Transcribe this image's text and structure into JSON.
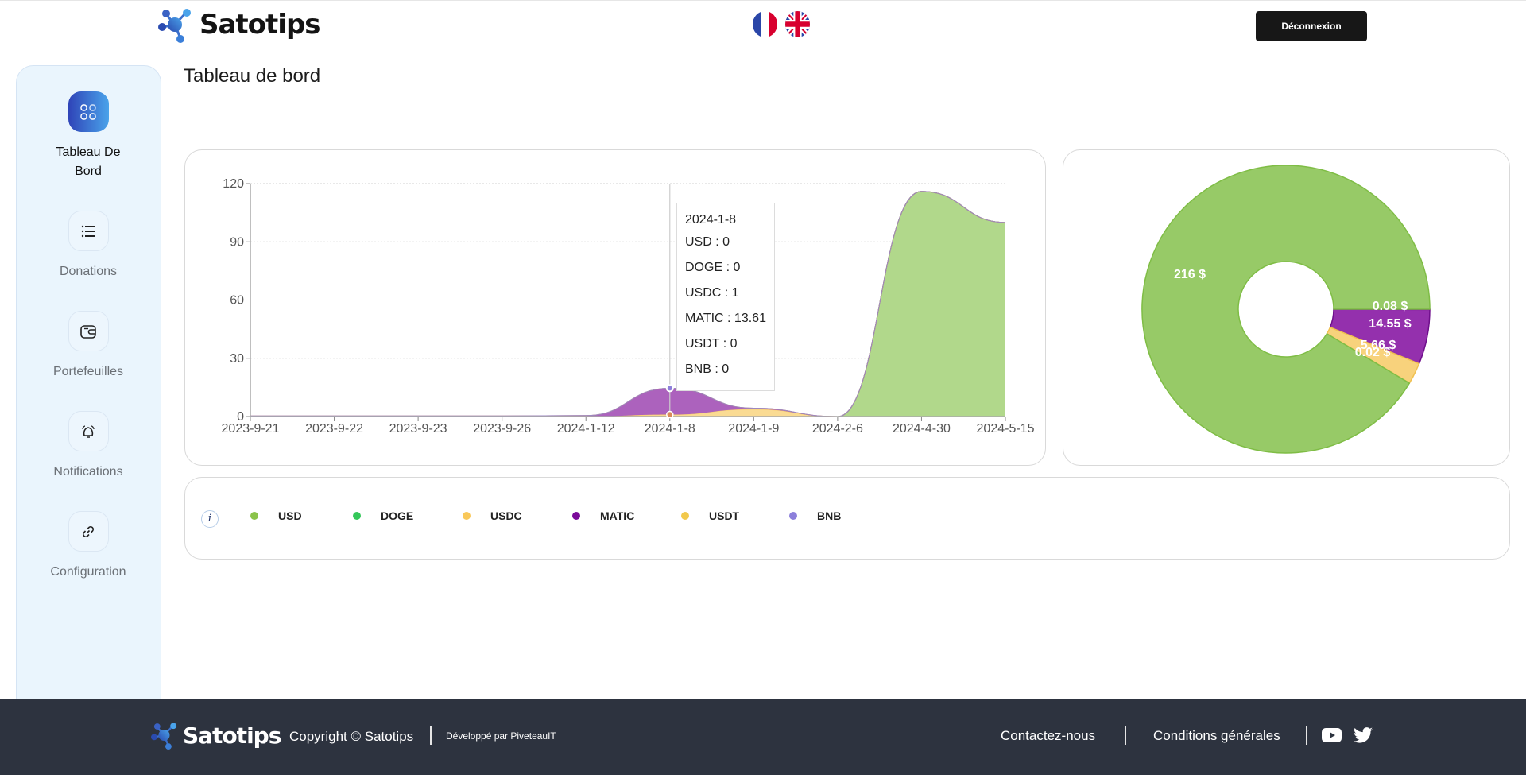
{
  "header": {
    "brand": "Satotips",
    "languages": [
      {
        "code": "fr",
        "label": "Français"
      },
      {
        "code": "en",
        "label": "English"
      }
    ],
    "logout_label": "Déconnexion"
  },
  "sidebar": {
    "items": [
      {
        "label": "Tableau De Bord",
        "icon": "dashboard-icon",
        "active": true
      },
      {
        "label": "Donations",
        "icon": "list-icon",
        "active": false
      },
      {
        "label": "Portefeuilles",
        "icon": "wallet-icon",
        "active": false
      },
      {
        "label": "Notifications",
        "icon": "bell-icon",
        "active": false
      },
      {
        "label": "Configuration",
        "icon": "link-icon",
        "active": false
      }
    ]
  },
  "page": {
    "title": "Tableau de bord"
  },
  "colors": {
    "USD": "#8bc34a",
    "DOGE": "#34c759",
    "USDC": "#f9c859",
    "MATIC": "#7b0a9a",
    "USDT": "#f2c94c",
    "BNB": "#8c7fdb",
    "footer_bg": "#2d333f"
  },
  "tooltip": {
    "date": "2024-1-8",
    "rows": [
      "USD : 0",
      "DOGE : 0",
      "USDC : 1",
      "MATIC : 13.61",
      "USDT : 0",
      "BNB : 0"
    ]
  },
  "legend": {
    "info_icon": "i",
    "items": [
      "USD",
      "DOGE",
      "USDC",
      "MATIC",
      "USDT",
      "BNB"
    ]
  },
  "chart_data": [
    {
      "type": "area",
      "stacked": true,
      "title": "",
      "xlabel": "",
      "ylabel": "",
      "categories": [
        "2023-9-21",
        "2023-9-22",
        "2023-9-23",
        "2023-9-26",
        "2024-1-12",
        "2024-1-8",
        "2024-1-9",
        "2024-2-6",
        "2024-4-30",
        "2024-5-15"
      ],
      "ylim": [
        0,
        120
      ],
      "yticks": [
        0,
        30,
        60,
        90,
        120
      ],
      "grid": true,
      "series": [
        {
          "name": "USD",
          "values": [
            0,
            0,
            0,
            0,
            0,
            0,
            0,
            0,
            116,
            100
          ]
        },
        {
          "name": "DOGE",
          "values": [
            0,
            0,
            0,
            0,
            0,
            0,
            0,
            0,
            0,
            0
          ]
        },
        {
          "name": "USDC",
          "values": [
            0,
            0,
            0,
            0,
            0,
            1,
            3.8,
            0,
            0,
            0
          ]
        },
        {
          "name": "MATIC",
          "values": [
            0.3,
            0.3,
            0.3,
            0.3,
            0.5,
            13.61,
            0.5,
            0,
            0,
            0
          ]
        },
        {
          "name": "USDT",
          "values": [
            0,
            0,
            0,
            0,
            0,
            0,
            0,
            0,
            0,
            0
          ]
        },
        {
          "name": "BNB",
          "values": [
            0,
            0,
            0,
            0,
            0,
            0,
            0,
            0,
            0,
            0
          ]
        }
      ],
      "tooltip_category": "2024-1-8"
    },
    {
      "type": "pie",
      "donut": true,
      "slices": [
        {
          "name": "BNB",
          "value": 0.08,
          "label": "0.08 $"
        },
        {
          "name": "MATIC",
          "value": 14.55,
          "label": "14.55 $"
        },
        {
          "name": "USDC",
          "value": 5.66,
          "label": "5.66 $"
        },
        {
          "name": "USDT",
          "value": 0.02,
          "label": "0.02 $"
        },
        {
          "name": "USD",
          "value": 216,
          "label": "216 $"
        }
      ]
    }
  ],
  "footer": {
    "brand": "Satotips",
    "copyright": "Copyright © Satotips",
    "developer": "Développé par PiveteauIT",
    "links": [
      "Contactez-nous",
      "Conditions générales"
    ],
    "social": [
      "youtube",
      "twitter"
    ]
  }
}
